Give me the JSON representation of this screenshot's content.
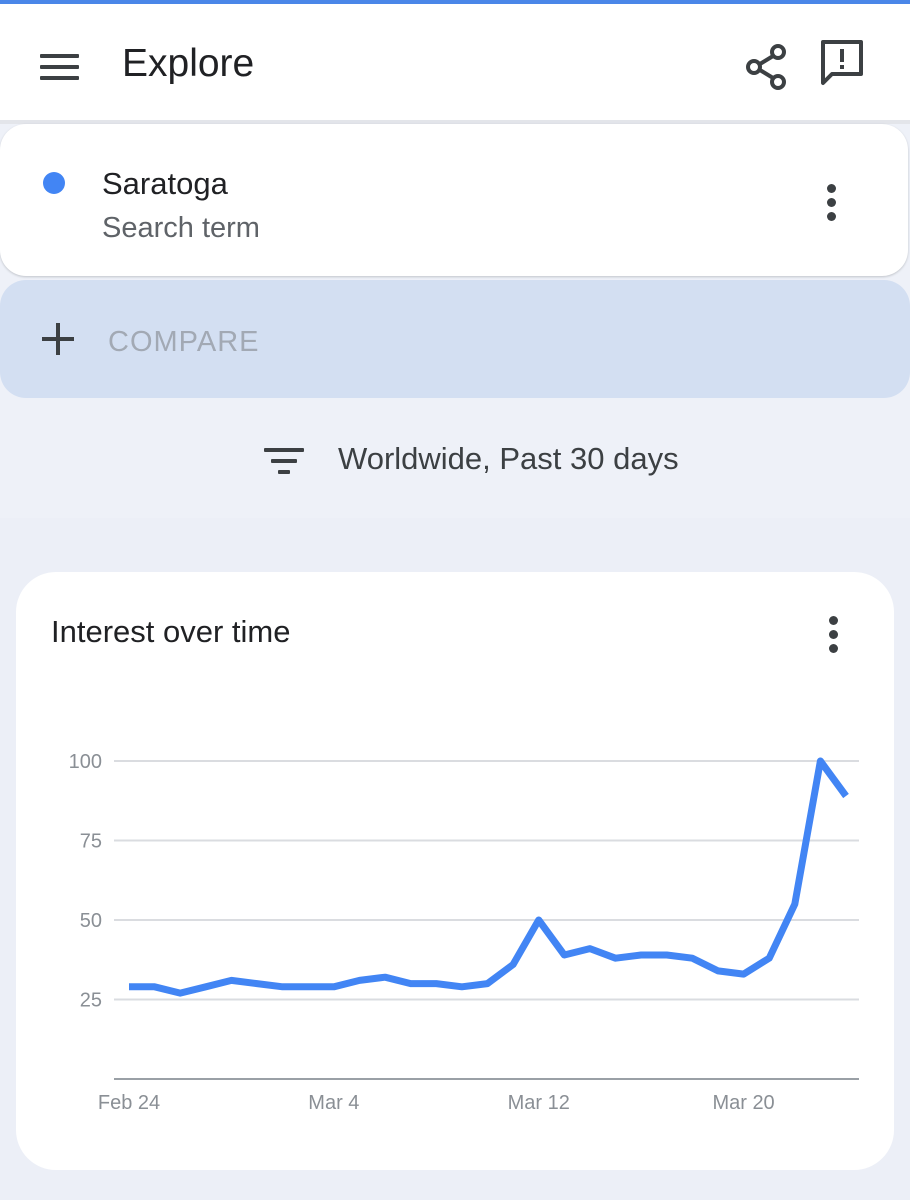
{
  "app_bar": {
    "title": "Explore",
    "menu_icon": "hamburger-menu-icon",
    "share_icon": "share-icon",
    "feedback_icon": "feedback-icon"
  },
  "search_term": {
    "name": "Saratoga",
    "type": "Search term",
    "color": "#4285f4"
  },
  "compare": {
    "label": "COMPARE"
  },
  "filter": {
    "text": "Worldwide, Past 30 days",
    "icon": "filter-icon"
  },
  "colors": {
    "accent": "#4285f4",
    "compare_bg": "#d3dff2",
    "page_bg": "#eef1f8"
  },
  "chart_card": {
    "title": "Interest over time"
  },
  "chart_data": {
    "type": "line",
    "ylim": [
      0,
      100
    ],
    "y_ticks": [
      25,
      50,
      75,
      100
    ],
    "x_tick_labels": [
      "Feb 24",
      "Mar 4",
      "Mar 12",
      "Mar 20"
    ],
    "x_tick_days": [
      0,
      8,
      16,
      24
    ],
    "grid": true,
    "legend": "none",
    "series": [
      {
        "color": "#4285f4",
        "x": [
          0,
          1,
          2,
          3,
          4,
          5,
          6,
          7,
          8,
          9,
          10,
          11,
          12,
          13,
          14,
          15,
          16,
          17,
          18,
          19,
          20,
          21,
          22,
          23,
          24,
          25,
          26,
          27,
          28
        ],
        "values": [
          29,
          29,
          27,
          29,
          31,
          30,
          29,
          29,
          29,
          31,
          32,
          30,
          30,
          29,
          30,
          36,
          50,
          39,
          41,
          38,
          39,
          39,
          38,
          34,
          33,
          38,
          55,
          100,
          89
        ]
      }
    ]
  }
}
